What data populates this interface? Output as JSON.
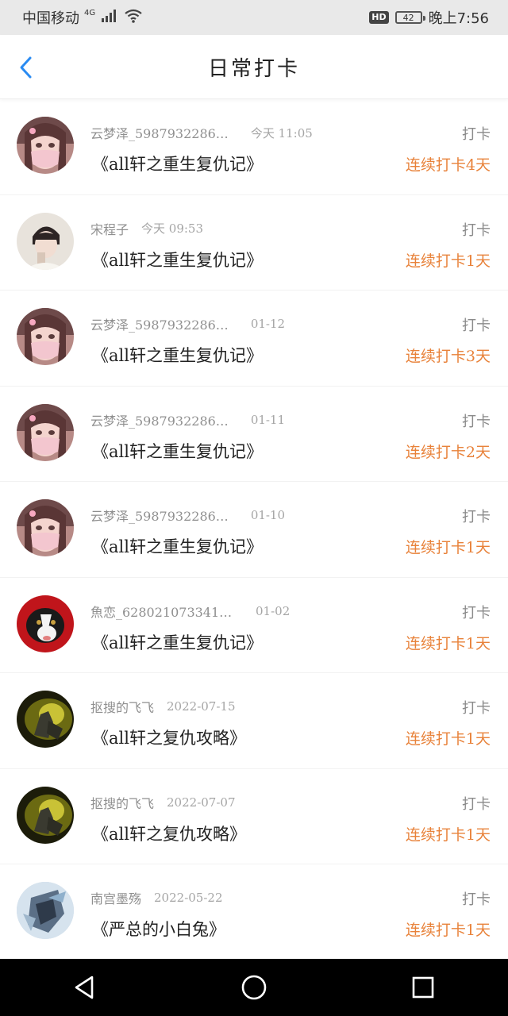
{
  "status_bar": {
    "carrier": "中国移动",
    "network": "4G",
    "hd": "HD",
    "battery": "42",
    "time": "晚上7:56",
    "icons": [
      "signal-icon",
      "wifi-icon",
      "battery-icon"
    ]
  },
  "header": {
    "title": "日常打卡",
    "back_icon": "chevron-left-icon",
    "accent": "#2a8bf2"
  },
  "colors": {
    "streak": "#e8823a",
    "name": "#8f8f8f",
    "nav_bg": "#000000"
  },
  "rows": [
    {
      "name": "云梦泽_5987932286…",
      "time": "今天 11:05",
      "book": "《all轩之重生复仇记》",
      "action": "打卡",
      "streak": "连续打卡4天",
      "avatar": "avatar-girl-mask"
    },
    {
      "name": "宋程子",
      "time": "今天 09:53",
      "book": "《all轩之重生复仇记》",
      "action": "打卡",
      "streak": "连续打卡1天",
      "avatar": "avatar-boy"
    },
    {
      "name": "云梦泽_5987932286…",
      "time": "01-12",
      "book": "《all轩之重生复仇记》",
      "action": "打卡",
      "streak": "连续打卡3天",
      "avatar": "avatar-girl-mask"
    },
    {
      "name": "云梦泽_5987932286…",
      "time": "01-11",
      "book": "《all轩之重生复仇记》",
      "action": "打卡",
      "streak": "连续打卡2天",
      "avatar": "avatar-girl-mask"
    },
    {
      "name": "云梦泽_5987932286…",
      "time": "01-10",
      "book": "《all轩之重生复仇记》",
      "action": "打卡",
      "streak": "连续打卡1天",
      "avatar": "avatar-girl-mask"
    },
    {
      "name": "魚恋_6280210733412…",
      "time": "01-02",
      "book": "《all轩之重生复仇记》",
      "action": "打卡",
      "streak": "连续打卡1天",
      "avatar": "avatar-dog"
    },
    {
      "name": "抠搜的飞飞",
      "time": "2022-07-15",
      "book": "《all轩之复仇攻略》",
      "action": "打卡",
      "streak": "连续打卡1天",
      "avatar": "avatar-stage"
    },
    {
      "name": "抠搜的飞飞",
      "time": "2022-07-07",
      "book": "《all轩之复仇攻略》",
      "action": "打卡",
      "streak": "连续打卡1天",
      "avatar": "avatar-stage"
    },
    {
      "name": "南宫墨殇",
      "time": "2022-05-22",
      "book": "《严总的小白兔》",
      "action": "打卡",
      "streak": "连续打卡1天",
      "avatar": "avatar-anime"
    }
  ],
  "nav": {
    "back": "nav-back-icon",
    "home": "nav-home-icon",
    "recents": "nav-recents-icon"
  }
}
